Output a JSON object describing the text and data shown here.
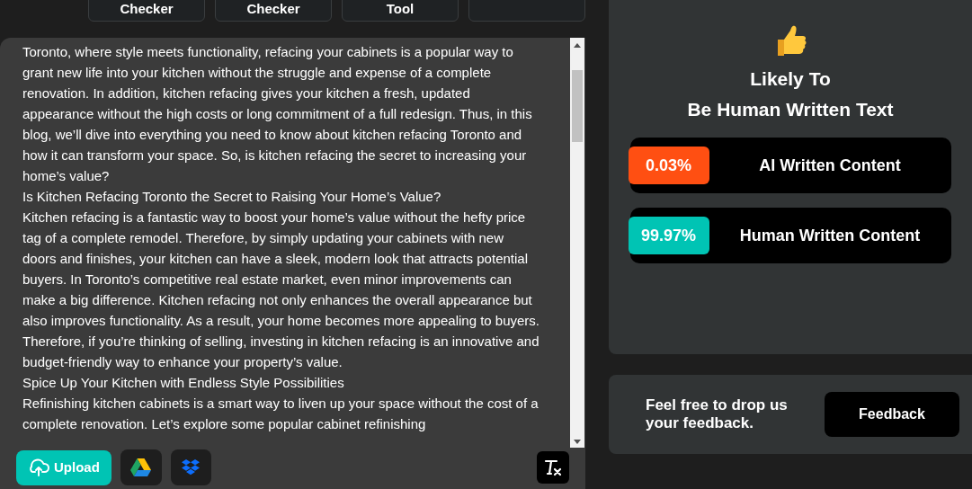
{
  "nav_buttons": [
    {
      "kind": "text",
      "label": "Checker"
    },
    {
      "kind": "text",
      "label": "Checker"
    },
    {
      "kind": "text",
      "label": "Tool"
    },
    {
      "kind": "blank"
    }
  ],
  "editor": {
    "paragraphs": [
      "Toronto, where style meets functionality, refacing your cabinets is a popular way to grant new life into your kitchen without the struggle and expense of a complete renovation. In addition, kitchen refacing gives your kitchen a fresh, updated appearance without the high costs or long commitment of a full redesign. Thus, in this blog, we’ll dive into everything you need to know about kitchen refacing Toronto and how it can transform your space. So, is kitchen refacing the secret to increasing your home’s value?",
      "Is Kitchen Refacing Toronto the Secret to Raising Your Home’s Value?",
      "Kitchen refacing is a fantastic way to boost your home’s value without the hefty price tag of a complete remodel. Therefore, by simply updating your cabinets with new doors and finishes, your kitchen can have a sleek, modern look that attracts potential buyers. In Toronto’s competitive real estate market, even minor improvements can make a big difference. Kitchen refacing not only enhances the overall appearance but also improves functionality. As a result, your home becomes more appealing to buyers. Therefore, if you’re thinking of selling, investing in kitchen refacing is an innovative and budget-friendly way to enhance your property’s value.",
      "Spice Up Your Kitchen with Endless Style Possibilities",
      "Refinishing kitchen cabinets is a smart way to liven up your space without the cost of a complete renovation. Let’s explore some popular cabinet refinishing"
    ],
    "upload_button": "Upload"
  },
  "result": {
    "title_lines": [
      "Likely To",
      "Be Human Written Text"
    ],
    "scores": [
      {
        "value": "0.03%",
        "label": "AI Written Content",
        "color": "#ff4f12"
      },
      {
        "value": "99.97%",
        "label": "Human Written Content",
        "color": "#00c4b4"
      }
    ]
  },
  "feedback": {
    "text": "Feel free to drop us your feedback.",
    "button": "Feedback"
  }
}
